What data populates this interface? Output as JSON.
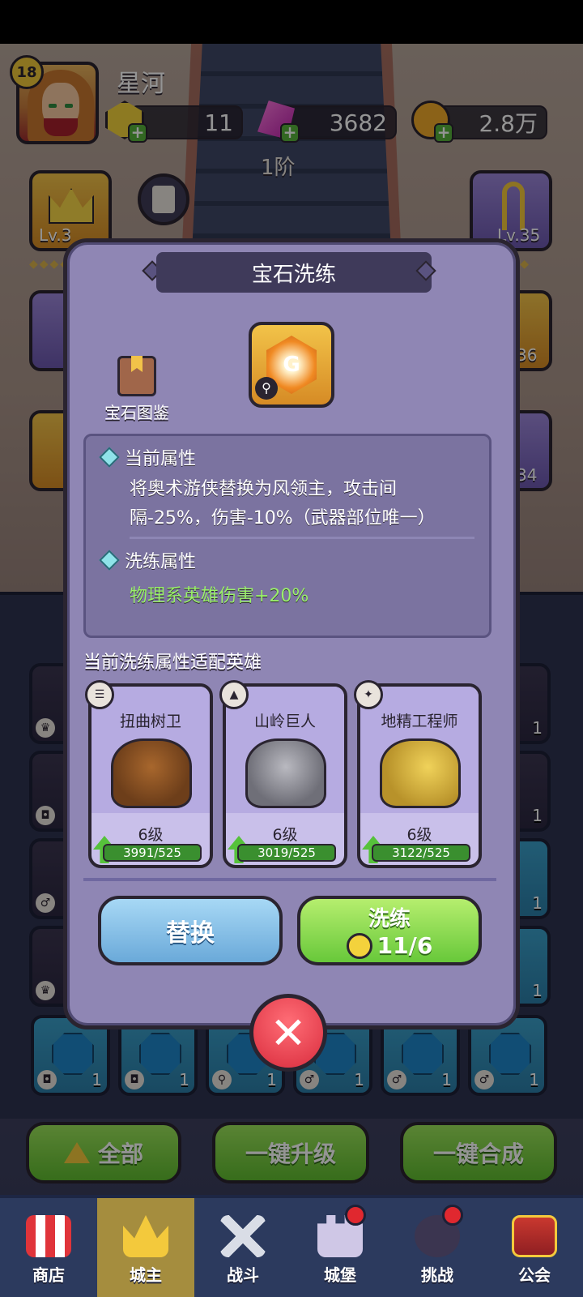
{
  "player": {
    "name": "星河",
    "level": "18",
    "rank": "1阶"
  },
  "resources": {
    "gold_gems": "11",
    "crystals": "3682",
    "coins": "2.8万"
  },
  "side_slots": {
    "left_top_level": "Lv.3",
    "right_top_level": "Lv.35",
    "right_mid_level": "36",
    "right_low_level": "34"
  },
  "modal": {
    "title": "宝石洗练",
    "codex_label": "宝石图鉴",
    "current_attr_title": "当前属性",
    "current_attr_text": "将奥术游侠替换为风领主，攻击间隔-25%，伤害-10%（武器部位唯一）",
    "refine_attr_title": "洗练属性",
    "refine_attr_text": "物理系英雄伤害+20%",
    "fit_title": "当前洗练属性适配英雄",
    "heroes": [
      {
        "name": "扭曲树卫",
        "level": "6级",
        "progress": "3991/525"
      },
      {
        "name": "山岭巨人",
        "level": "6级",
        "progress": "3019/525"
      },
      {
        "name": "地精工程师",
        "level": "6级",
        "progress": "3122/525"
      }
    ],
    "replace_label": "替换",
    "refine_label": "洗练",
    "refine_cost": "11/6"
  },
  "grid_counts": {
    "c1": "1",
    "c2": "1",
    "c3": "1",
    "c4": "1",
    "c5": "1",
    "c6": "1",
    "r1": "1",
    "r2": "1",
    "r3": "1",
    "r4": "1"
  },
  "bottom_actions": {
    "all": "全部",
    "upgrade": "一键升级",
    "merge": "一键合成"
  },
  "nav": {
    "shop": "商店",
    "lord": "城主",
    "battle": "战斗",
    "castle": "城堡",
    "challenge": "挑战",
    "guild": "公会"
  }
}
